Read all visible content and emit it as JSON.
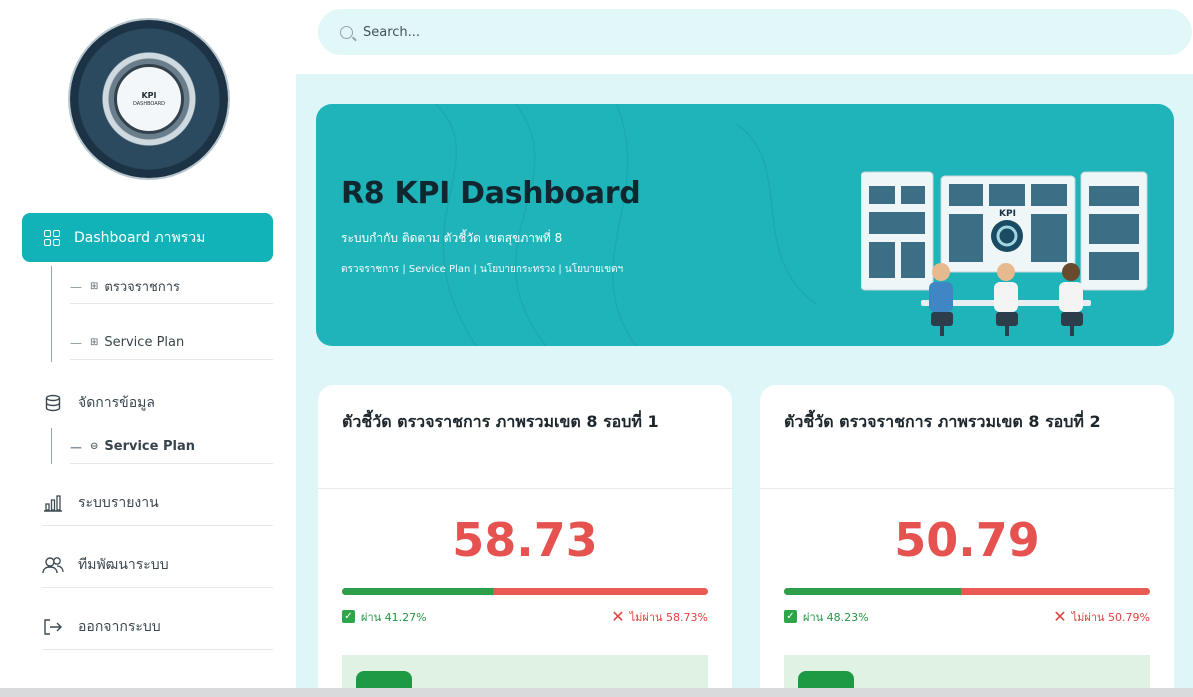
{
  "sidebar": {
    "logo": {
      "line1": "KPI",
      "line2": "DASHBOARD"
    },
    "active_item": {
      "label": "Dashboard ภาพรวม",
      "icon": "grid-icon"
    },
    "sub_items_1": [
      {
        "label": "ตรวจราชการ",
        "icon": "grid-icon"
      },
      {
        "label": "Service Plan",
        "icon": "grid-icon"
      }
    ],
    "data_manage": {
      "label": "จัดการข้อมูล",
      "icon": "database-icon"
    },
    "sub_items_2": [
      {
        "label": "Service Plan",
        "icon": "database-icon"
      }
    ],
    "report": {
      "label": "ระบบรายงาน",
      "icon": "bar-chart-icon"
    },
    "team": {
      "label": "ทีมพัฒนาระบบ",
      "icon": "team-icon"
    },
    "logout": {
      "label": "ออกจากระบบ",
      "icon": "logout-icon"
    }
  },
  "search": {
    "placeholder": "Search..."
  },
  "hero": {
    "title": "R8 KPI Dashboard",
    "subtitle": "ระบบกำกับ ติดตาม ตัวชี้วัด เขตสุขภาพที่ 8",
    "tags": "ตรวจราชการ | Service Plan | นโยบายกระทรวง | นโยบายเขตฯ",
    "art_label": "KPI"
  },
  "cards": [
    {
      "title": "ตัวชี้วัด ตรวจราชการ ภาพรวมเขต 8 รอบที่ 1",
      "value": "58.73",
      "pass_fraction": 0.4127,
      "pass_label": "ผ่าน 41.27%",
      "fail_label": "ไม่ผ่าน 58.73%"
    },
    {
      "title": "ตัวชี้วัด ตรวจราชการ ภาพรวมเขต 8 รอบที่ 2",
      "value": "50.79",
      "pass_fraction": 0.4823,
      "pass_label": "ผ่าน 48.23%",
      "fail_label": "ไม่ผ่าน 50.79%"
    }
  ],
  "colors": {
    "accent": "#12b3b8",
    "hero_bg": "#1fb4ba",
    "value_red": "#e5524f",
    "pass_green": "#2d9f4a",
    "fail_red": "#ea5a55"
  }
}
